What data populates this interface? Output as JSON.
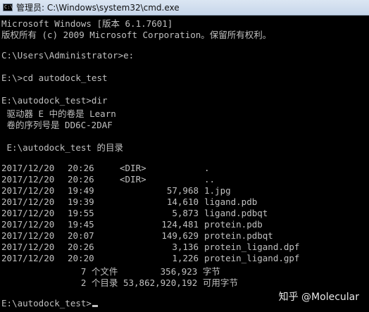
{
  "window": {
    "title": "管理员: C:\\Windows\\system32\\cmd.exe",
    "icon": "command-prompt-icon"
  },
  "console": {
    "header": [
      "Microsoft Windows [版本 6.1.7601]",
      "版权所有 (c) 2009 Microsoft Corporation。保留所有权利。"
    ],
    "commands": [
      "C:\\Users\\Administrator>e:",
      "E:\\>cd autodock_test",
      "E:\\autodock_test>dir"
    ],
    "volume": [
      " 驱动器 E 中的卷是 Learn",
      " 卷的序列号是 DD6C-2DAF"
    ],
    "dir_of": " E:\\autodock_test 的目录",
    "entries": [
      {
        "date": "2017/12/20",
        "time": "20:26",
        "dir": "<DIR>",
        "size": "",
        "name": "."
      },
      {
        "date": "2017/12/20",
        "time": "20:26",
        "dir": "<DIR>",
        "size": "",
        "name": ".."
      },
      {
        "date": "2017/12/20",
        "time": "19:49",
        "dir": "",
        "size": "57,968",
        "name": "1.jpg"
      },
      {
        "date": "2017/12/20",
        "time": "19:39",
        "dir": "",
        "size": "14,610",
        "name": "ligand.pdb"
      },
      {
        "date": "2017/12/20",
        "time": "19:55",
        "dir": "",
        "size": "5,873",
        "name": "ligand.pdbqt"
      },
      {
        "date": "2017/12/20",
        "time": "19:45",
        "dir": "",
        "size": "124,481",
        "name": "protein.pdb"
      },
      {
        "date": "2017/12/20",
        "time": "20:07",
        "dir": "",
        "size": "149,629",
        "name": "protein.pdbqt"
      },
      {
        "date": "2017/12/20",
        "time": "20:26",
        "dir": "",
        "size": "3,136",
        "name": "protein_ligand.dpf"
      },
      {
        "date": "2017/12/20",
        "time": "20:20",
        "dir": "",
        "size": "1,226",
        "name": "protein_ligand.gpf"
      }
    ],
    "summary": [
      "               7 个文件        356,923 字节",
      "               2 个目录 53,862,920,192 可用字节"
    ],
    "prompt": "E:\\autodock_test>"
  },
  "watermark": "知乎 @Molecular",
  "colors": {
    "background": "#000000",
    "text": "#c0c0c0"
  }
}
